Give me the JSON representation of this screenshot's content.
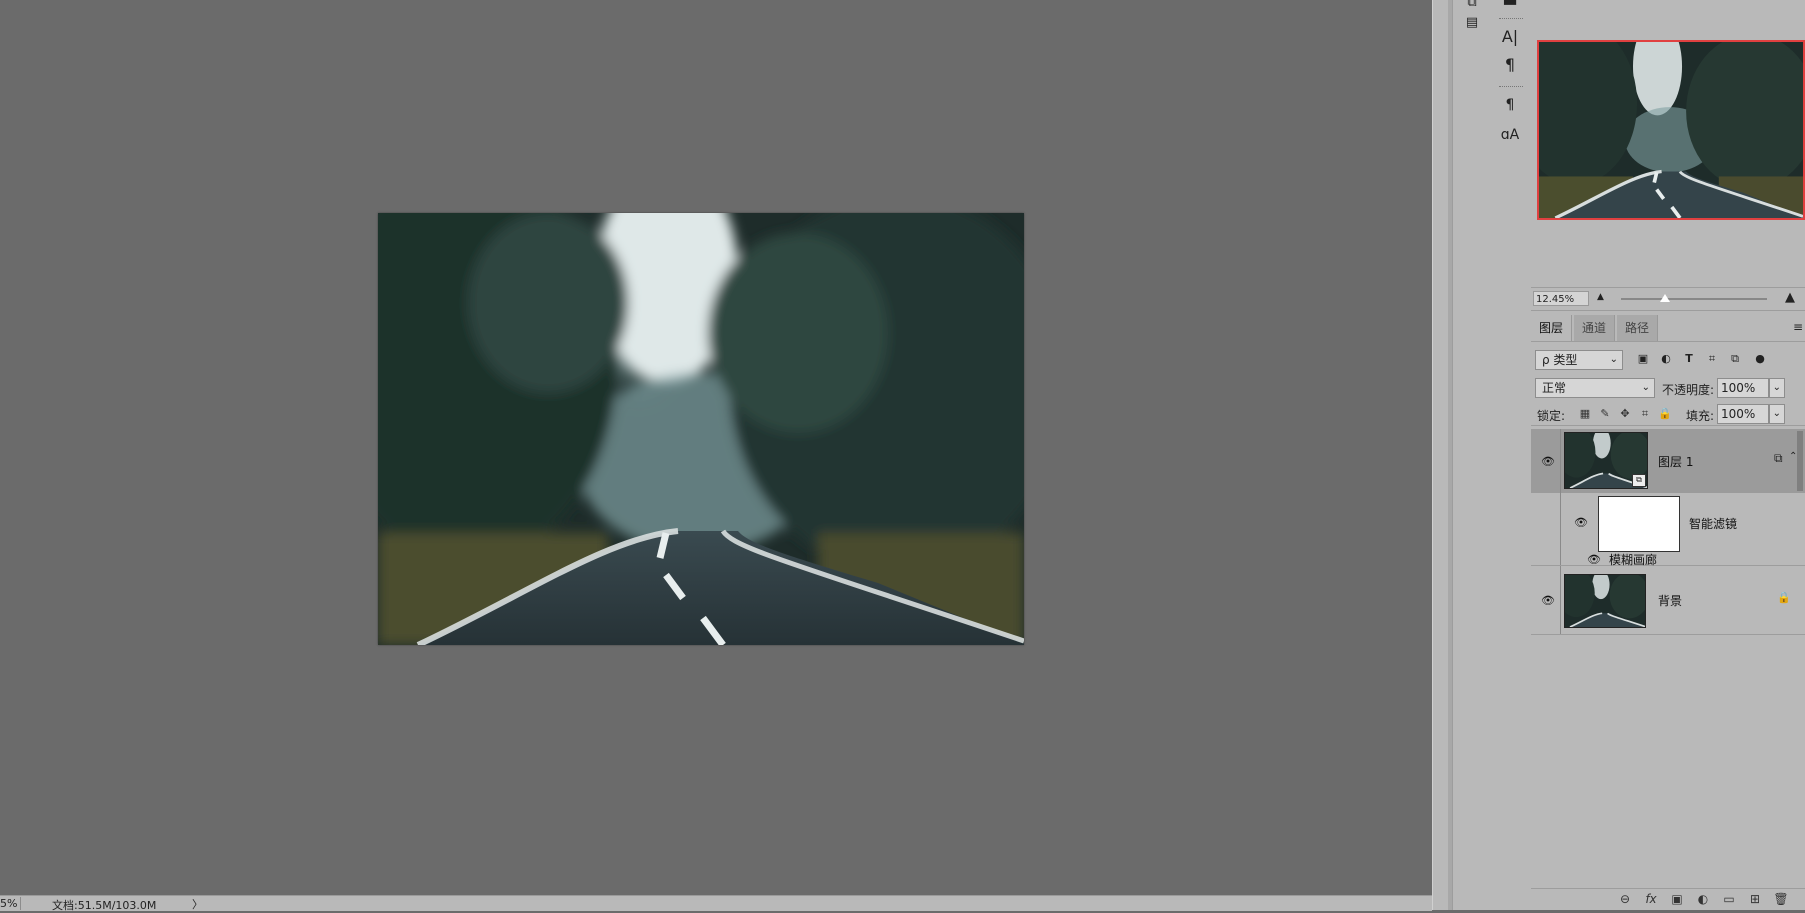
{
  "status_bar": {
    "zoom": "5%",
    "doc_info": "文档:51.5M/103.0M",
    "arrow": "〉"
  },
  "tools_col1": [
    {
      "icon": "layers-doc-icon",
      "glyph": "⧉"
    },
    {
      "icon": "properties-icon",
      "glyph": "▤"
    }
  ],
  "tools_col2": [
    {
      "icon": "character-panel-icon",
      "glyph": "A|"
    },
    {
      "icon": "paragraph-panel-icon",
      "glyph": "¶"
    },
    {
      "icon": "paragraph-styles-icon",
      "glyph": "¶"
    },
    {
      "icon": "character-styles-icon",
      "glyph": "ɑA"
    }
  ],
  "navigator": {
    "zoom_value": "12.45%",
    "zoom_slider_fraction": 0.3
  },
  "tabs": [
    {
      "label": "图层",
      "active": true
    },
    {
      "label": "通道",
      "active": false
    },
    {
      "label": "路径",
      "active": false
    }
  ],
  "panel_menu_glyph": "≡",
  "filter": {
    "kind_label": "ρ 类型",
    "icons": [
      "image-filter-icon",
      "adjustment-filter-icon",
      "type-filter-icon",
      "shape-filter-icon",
      "smart-object-filter-icon",
      "filter-toggle-icon"
    ]
  },
  "blend": {
    "mode": "正常",
    "opacity_label": "不透明度:",
    "opacity_value": "100%"
  },
  "lock": {
    "label": "锁定:",
    "fill_label": "填充:",
    "fill_value": "100%"
  },
  "layers": {
    "layer1_name": "图层 1",
    "smart_filter_name": "智能滤镜",
    "filter_effect_name": "模糊画廊",
    "background_name": "背景"
  },
  "bottom_icons": [
    "link-layers-icon",
    "fx-icon",
    "add-mask-icon",
    "adjustment-layer-icon",
    "new-group-icon",
    "new-layer-icon",
    "delete-layer-icon"
  ],
  "bottom_glyphs": [
    "⊖",
    "fx",
    "▣",
    "◐",
    "▭",
    "⊞",
    "🗑"
  ]
}
